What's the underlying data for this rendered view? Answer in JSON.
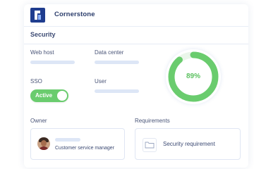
{
  "app": {
    "title": "Cornerstone",
    "logo_icon": "cornerstone-logo-icon",
    "brand_color": "#1f3d8f"
  },
  "security": {
    "title": "Security",
    "fields": {
      "web_host_label": "Web host",
      "data_center_label": "Data center",
      "sso_label": "SSO",
      "user_label": "User"
    },
    "sso_toggle": {
      "label": "Active",
      "on": true,
      "color": "#6acc6e"
    },
    "score": {
      "text": "89%",
      "value": 0.89,
      "color": "#6acc6e",
      "track_color": "#eaf6ea"
    }
  },
  "owner": {
    "label": "Owner",
    "role": "Customer service manager",
    "avatar_icon": "user-avatar"
  },
  "requirements": {
    "label": "Requirements",
    "item": "Security requirement",
    "item_icon": "folder-icon"
  }
}
